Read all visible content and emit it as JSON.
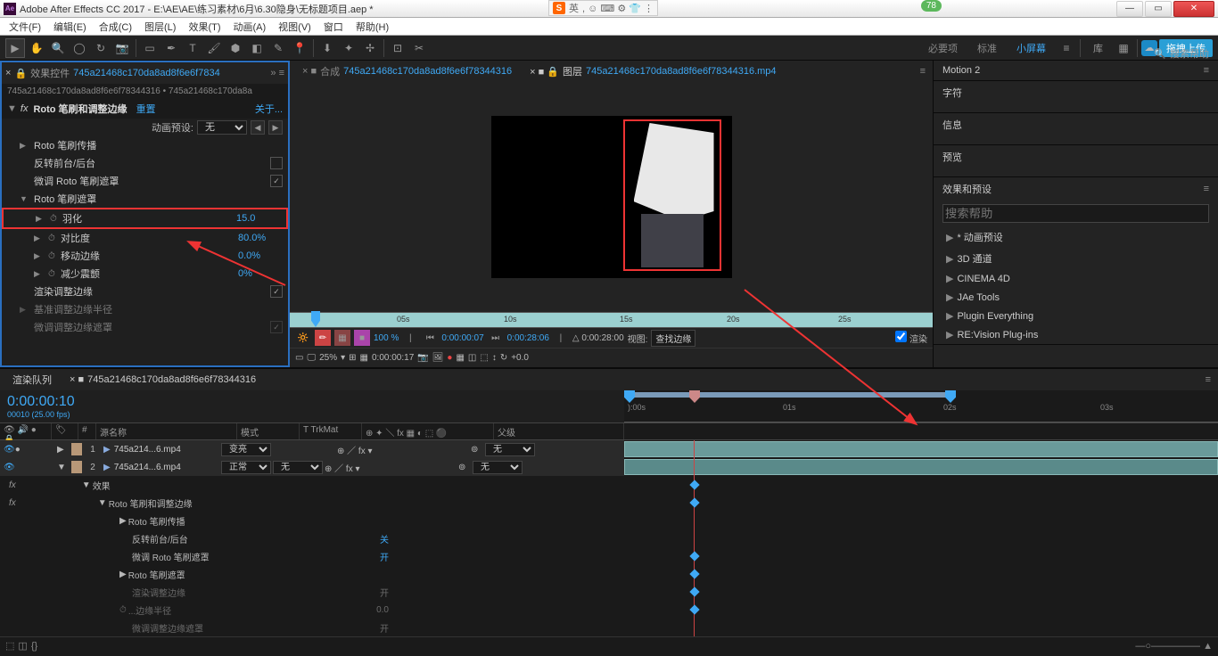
{
  "titlebar": {
    "app": "Adobe After Effects CC 2017",
    "path": "E:\\AE\\AE\\练习素材\\6月\\6.30隐身\\无标题项目.aep *"
  },
  "sogou": {
    "ime": "英",
    "badge": "78"
  },
  "menu": [
    "文件(F)",
    "编辑(E)",
    "合成(C)",
    "图层(L)",
    "效果(T)",
    "动画(A)",
    "视图(V)",
    "窗口",
    "帮助(H)"
  ],
  "workspaces": {
    "w1": "必要项",
    "w2": "标准",
    "w3": "小屏幕",
    "lib": "库",
    "search": "搜索帮助",
    "upload": "拖拽上传"
  },
  "effects": {
    "tabTitle": "效果控件",
    "tabLink": "745a21468c170da8ad8f6e6f7834",
    "crumb1": "745a21468c170da8ad8f6e6f78344316",
    "crumb2": "745a21468c170da8a",
    "fxName": "Roto 笔刷和调整边缘",
    "reset": "重置",
    "about": "关于...",
    "presetLabel": "动画预设:",
    "presetValue": "无",
    "rows": {
      "propagate": "Roto 笔刷传播",
      "invert": "反转前台/后台",
      "fineTune": "微调 Roto 笔刷遮罩",
      "matte": "Roto 笔刷遮罩",
      "feather": "羽化",
      "featherVal": "15.0",
      "contrast": "对比度",
      "contrastVal": "80.0%",
      "shift": "移动边缘",
      "shiftVal": "0.0%",
      "reduce": "减少震颤",
      "reduceVal": "0%",
      "refine": "渲染调整边缘",
      "radius": "基准调整边缘半径",
      "fineMatte": "微调调整边缘遮罩"
    }
  },
  "viewer": {
    "tab1": "合成",
    "tab1link": "745a21468c170da8ad8f6e6f78344316",
    "tab2": "图层",
    "tab2link": "745a21468c170da8ad8f6e6f78344316.mp4",
    "ticks": [
      "05s",
      "10s",
      "15s",
      "20s",
      "25s"
    ],
    "pct": "100 %",
    "tc1": "0:00:00:07",
    "tc2": "0:00:28:06",
    "tc3": "0:00:28:00",
    "viewLabel": "视图:",
    "viewMode": "查找边缘",
    "render": "渲染",
    "zoom": "25%",
    "tc4": "0:00:00:17",
    "plus": "+0.0"
  },
  "right": {
    "motion": "Motion 2",
    "char": "字符",
    "info": "信息",
    "preview": "预览",
    "ep": "效果和预设",
    "items": [
      "* 动画预设",
      "3D 通道",
      "CINEMA 4D",
      "JAe Tools",
      "Plugin Everything",
      "RE:Vision Plug-ins"
    ]
  },
  "timeline": {
    "tabRender": "渲染队列",
    "tabComp": "745a21468c170da8ad8f6e6f78344316",
    "tc": "0:00:00:10",
    "tcsub": "00010 (25.00 fps)",
    "ticks": [
      "):00s",
      "01s",
      "02s",
      "03s"
    ],
    "cols": {
      "src": "源名称",
      "mode": "模式",
      "trk": "T  TrkMat",
      "parent": "父级"
    },
    "layers": [
      {
        "num": "1",
        "name": "745a214...6.mp4",
        "mode": "变亮",
        "trk": "",
        "parent": "无"
      },
      {
        "num": "2",
        "name": "745a214...6.mp4",
        "mode": "正常",
        "trk": "无",
        "parent": "无"
      }
    ],
    "fx": {
      "root": "效果",
      "rotobrush": "Roto 笔刷和调整边缘",
      "propagate": "Roto 笔刷传播",
      "invert": "反转前台/后台",
      "invertVal": "关",
      "fineTune": "微调 Roto 笔刷遮罩",
      "fineTuneVal": "开",
      "matte": "Roto 笔刷遮罩",
      "refine": "渲染调整边缘",
      "refineVal": "开",
      "radius": "...边缘半径",
      "radiusVal": "0.0",
      "fineMatte": "微调调整边缘遮罩",
      "fineMatteVal": "开"
    }
  }
}
